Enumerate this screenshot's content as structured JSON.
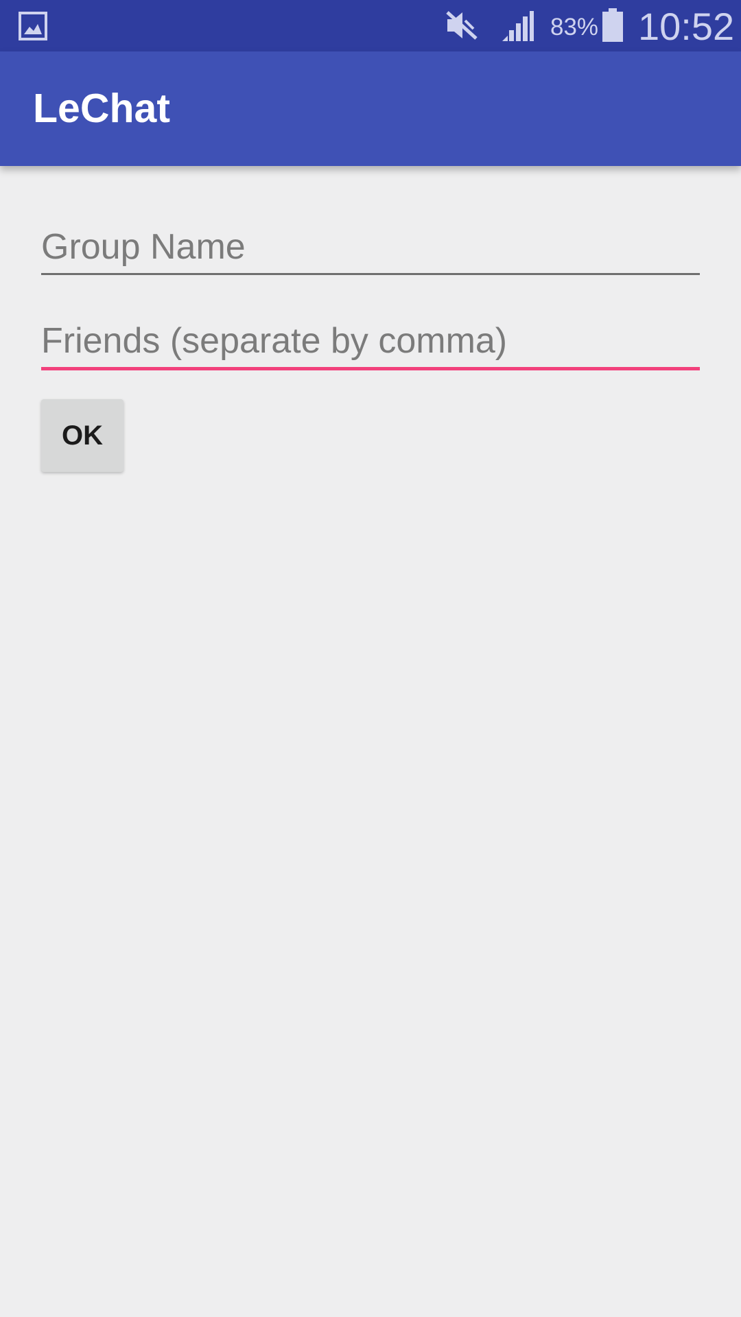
{
  "status_bar": {
    "notification_icon": "gallery-icon",
    "mute_icon": "mute-icon",
    "signal_icon": "signal-icon",
    "battery_percent": "83%",
    "battery_icon": "battery-icon",
    "time": "10:52",
    "color": "#2f3d9f"
  },
  "app_bar": {
    "title": "LeChat",
    "color": "#3f51b5"
  },
  "form": {
    "group_name": {
      "placeholder": "Group Name",
      "value": ""
    },
    "friends": {
      "placeholder": "Friends (separate by comma)",
      "value": "",
      "focused": true,
      "accent_color": "#f2417c"
    },
    "ok_label": "OK"
  }
}
